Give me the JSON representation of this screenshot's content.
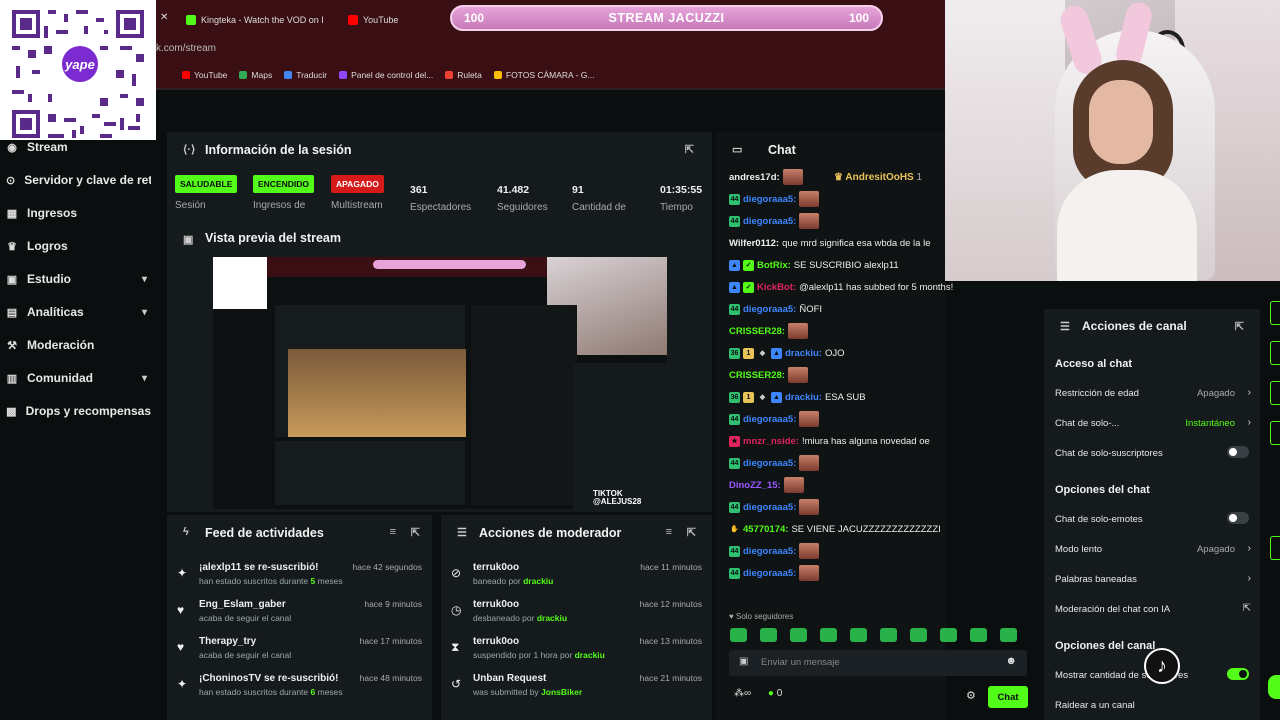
{
  "browser": {
    "tabs": [
      {
        "label": "Kingteka - Watch the VOD on I",
        "color": "#53fc18"
      },
      {
        "label": "YouTube",
        "color": "#ff0000"
      }
    ],
    "url": "k.com/stream",
    "bookmarks": [
      {
        "label": "YouTube",
        "color": "#ff0000"
      },
      {
        "label": "Maps",
        "color": "#34a853"
      },
      {
        "label": "Traducir",
        "color": "#4285f4"
      },
      {
        "label": "Panel de control del...",
        "color": "#9146ff"
      },
      {
        "label": "Ruleta",
        "color": "#ea4335"
      },
      {
        "label": "FOTOS CÁMARA - G...",
        "color": "#fbbc05"
      }
    ]
  },
  "hype_bar": {
    "left_value": "100",
    "title": "STREAM JACUZZI",
    "right_value": "100"
  },
  "qr": {
    "brand": "yape"
  },
  "sidebar": {
    "items": [
      {
        "label": "Stream",
        "icon": "stream-icon",
        "has_chevron": false
      },
      {
        "label": "Servidor y clave de retransmisión",
        "icon": "server-icon",
        "has_chevron": false
      },
      {
        "label": "Ingresos",
        "icon": "income-icon",
        "has_chevron": false
      },
      {
        "label": "Logros",
        "icon": "trophy-icon",
        "has_chevron": false
      },
      {
        "label": "Estudio",
        "icon": "studio-icon",
        "has_chevron": true
      },
      {
        "label": "Analíticas",
        "icon": "analytics-icon",
        "has_chevron": true
      },
      {
        "label": "Moderación",
        "icon": "hammer-icon",
        "has_chevron": false
      },
      {
        "label": "Comunidad",
        "icon": "community-icon",
        "has_chevron": true
      },
      {
        "label": "Drops y recompensas",
        "icon": "gift-icon",
        "has_chevron": false
      }
    ]
  },
  "session": {
    "title": "Información de la sesión",
    "stats": [
      {
        "kind": "badge",
        "value": "SALUDABLE",
        "tone": "green",
        "label": "Sesión"
      },
      {
        "kind": "badge",
        "value": "ENCENDIDO",
        "tone": "green",
        "label": "Ingresos de"
      },
      {
        "kind": "badge",
        "value": "APAGADO",
        "tone": "red",
        "label": "Multistream"
      },
      {
        "kind": "number",
        "value": "361",
        "label": "Espectadores"
      },
      {
        "kind": "number",
        "value": "41.482",
        "label": "Seguidores"
      },
      {
        "kind": "number",
        "value": "91",
        "label": "Cantidad de"
      },
      {
        "kind": "number",
        "value": "01:35:55",
        "label": "Tiempo"
      }
    ]
  },
  "preview": {
    "title": "Vista previa del stream",
    "overlay_text": "TIKTOK @ALEJUS28"
  },
  "activity_feed": {
    "title": "Feed de actividades",
    "items": [
      {
        "icon": "sparkle-icon",
        "title": "¡alexlp11 se re-suscribió!",
        "sub_pre": "han estado suscritos durante ",
        "sub_hl": "5",
        "sub_post": " meses",
        "time": "hace 42 segundos"
      },
      {
        "icon": "heart-icon",
        "title": "Eng_Eslam_gaber",
        "sub_pre": "acaba de seguir el canal",
        "sub_hl": "",
        "sub_post": "",
        "time": "hace 9 minutos"
      },
      {
        "icon": "heart-icon",
        "title": "Therapy_try",
        "sub_pre": "acaba de seguir el canal",
        "sub_hl": "",
        "sub_post": "",
        "time": "hace 17 minutos"
      },
      {
        "icon": "sparkle-icon",
        "title": "¡ChoninosTV se re-suscribió!",
        "sub_pre": "han estado suscritos durante ",
        "sub_hl": "6",
        "sub_post": " meses",
        "time": "hace 48 minutos"
      }
    ]
  },
  "mod_actions": {
    "title": "Acciones de moderador",
    "items": [
      {
        "icon": "ban-icon",
        "title": "terruk0oo",
        "sub_pre": "baneado por ",
        "sub_hl": "drackiu",
        "time": "hace 11 minutos"
      },
      {
        "icon": "clock-icon",
        "title": "terruk0oo",
        "sub_pre": "desbaneado por ",
        "sub_hl": "drackiu",
        "time": "hace 12 minutos"
      },
      {
        "icon": "hourglass-icon",
        "title": "terruk0oo",
        "sub_pre": "suspendido por 1 hora por ",
        "sub_hl": "drackiu",
        "time": "hace 13 minutos"
      },
      {
        "icon": "undo-icon",
        "title": "Unban Request",
        "sub_pre": "was submitted by ",
        "sub_hl": "JonsBiker",
        "time": "hace 21 minutos"
      }
    ]
  },
  "chat": {
    "title": "Chat",
    "pinned_user": "AndresitOoHS",
    "pinned_count": "1",
    "messages": [
      {
        "user": "andres17d:",
        "color": "#f0f0f0",
        "text": "",
        "emote": true,
        "badges": []
      },
      {
        "user": "diegoraaa5:",
        "color": "#3d86ff",
        "text": "",
        "emote": true,
        "badges": [
          "44"
        ]
      },
      {
        "user": "diegoraaa5:",
        "color": "#3d86ff",
        "text": "",
        "emote": true,
        "badges": [
          "44"
        ]
      },
      {
        "user": "Wilfer0112:",
        "color": "#f0f0f0",
        "text": "que mrd significa esa wbda de la le",
        "emote": false,
        "badges": []
      },
      {
        "user": "BotRix:",
        "color": "#53fc18",
        "text": "SE SUSCRIBIO alexlp11",
        "emote": false,
        "badges": [
          "bot",
          "check"
        ]
      },
      {
        "user": "KickBot:",
        "color": "#e0245e",
        "text": "@alexlp11 has subbed for 5 months!",
        "emote": false,
        "badges": [
          "bot",
          "check"
        ]
      },
      {
        "user": "diegoraaa5:",
        "color": "#3d86ff",
        "text": "ÑOFI",
        "emote": false,
        "badges": [
          "44"
        ]
      },
      {
        "user": "CRISSER28:",
        "color": "#53fc18",
        "text": "",
        "emote": true,
        "badges": []
      },
      {
        "user": "drackiu:",
        "color": "#3d86ff",
        "text": "OJO",
        "emote": false,
        "badges": [
          "36",
          "1",
          "mod",
          "bot"
        ]
      },
      {
        "user": "CRISSER28:",
        "color": "#53fc18",
        "text": "",
        "emote": true,
        "badges": []
      },
      {
        "user": "drackiu:",
        "color": "#3d86ff",
        "text": "ESA SUB",
        "emote": false,
        "badges": [
          "36",
          "1",
          "mod",
          "bot"
        ]
      },
      {
        "user": "diegoraaa5:",
        "color": "#3d86ff",
        "text": "",
        "emote": true,
        "badges": [
          "44"
        ]
      },
      {
        "user": "mnzr_nside:",
        "color": "#e0245e",
        "text": "!miura has alguna novedad oe",
        "emote": false,
        "badges": [
          "sub"
        ]
      },
      {
        "user": "diegoraaa5:",
        "color": "#3d86ff",
        "text": "",
        "emote": true,
        "badges": [
          "44"
        ]
      },
      {
        "user": "DinoZZ_15:",
        "color": "#9b59ff",
        "text": "",
        "emote": true,
        "badges": []
      },
      {
        "user": "diegoraaa5:",
        "color": "#3d86ff",
        "text": "",
        "emote": true,
        "badges": [
          "44"
        ]
      },
      {
        "user": "45770174:",
        "color": "#53fc18",
        "text": "SE VIENE JACUZZZZZZZZZZZZZI",
        "emote": false,
        "badges": [
          "hand"
        ]
      },
      {
        "user": "diegoraaa5:",
        "color": "#3d86ff",
        "text": "",
        "emote": true,
        "badges": [
          "44"
        ]
      },
      {
        "user": "diegoraaa5:",
        "color": "#3d86ff",
        "text": "",
        "emote": true,
        "badges": [
          "44"
        ]
      }
    ],
    "followers_only": "Solo seguidores",
    "input_placeholder": "Enviar un mensaje",
    "viewer_count": "0",
    "send_label": "Chat"
  },
  "channel_actions": {
    "title": "Acciones de canal",
    "sections": [
      {
        "heading": "Acceso al chat",
        "options": [
          {
            "label": "Restricción de edad",
            "value": "Apagado",
            "control": "arrow",
            "value_tone": "grey"
          },
          {
            "label": "Chat de solo-...",
            "value": "Instantáneo",
            "control": "arrow",
            "value_tone": "green"
          },
          {
            "label": "Chat de solo-suscriptores",
            "value": "",
            "control": "toggle-off",
            "value_tone": "grey"
          }
        ]
      },
      {
        "heading": "Opciones del chat",
        "options": [
          {
            "label": "Chat de solo-emotes",
            "value": "",
            "control": "toggle-off",
            "value_tone": "grey"
          },
          {
            "label": "Modo lento",
            "value": "Apagado",
            "control": "arrow",
            "value_tone": "grey"
          },
          {
            "label": "Palabras baneadas",
            "value": "",
            "control": "arrow",
            "value_tone": "grey"
          },
          {
            "label": "Moderación del chat con IA",
            "value": "",
            "control": "external",
            "value_tone": "grey"
          }
        ]
      },
      {
        "heading": "Opciones del canal",
        "options": [
          {
            "label": "Mostrar cantidad de seguidores",
            "value": "",
            "control": "toggle-on",
            "value_tone": "grey"
          },
          {
            "label": "Raidear a un canal",
            "value": "",
            "control": "none",
            "value_tone": "grey"
          }
        ]
      }
    ]
  }
}
